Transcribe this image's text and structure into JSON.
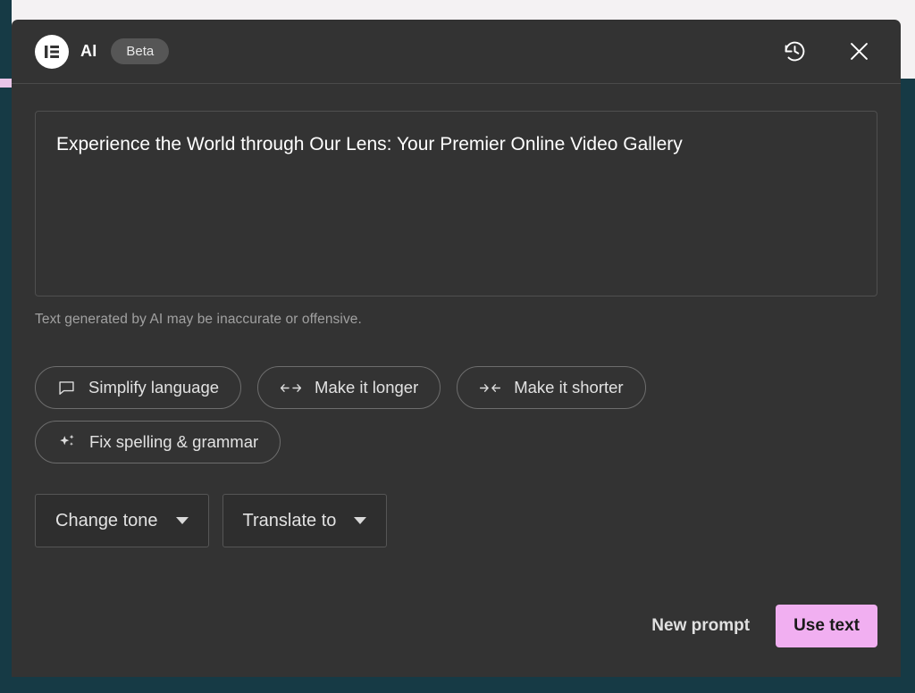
{
  "window": {
    "backdrop_color": "#163a45",
    "modal_background": "#333333",
    "accent_color": "#f1aff1"
  },
  "header": {
    "logo_icon": "elementor-logo-icon",
    "title": "AI",
    "badge": "Beta",
    "history_icon": "history-icon",
    "close_icon": "close-icon"
  },
  "main": {
    "generated_text": "Experience the World through Our Lens: Your Premier Online Video Gallery",
    "disclaimer": "Text generated by AI may be inaccurate or offensive.",
    "actions": [
      {
        "label": "Simplify language",
        "icon": "speech-bubble-icon"
      },
      {
        "label": "Make it longer",
        "icon": "expand-arrows-icon"
      },
      {
        "label": "Make it shorter",
        "icon": "collapse-arrows-icon"
      },
      {
        "label": "Fix spelling & grammar",
        "icon": "sparkles-icon"
      }
    ],
    "selects": [
      {
        "label": "Change tone",
        "icon": "chevron-down-icon"
      },
      {
        "label": "Translate to",
        "icon": "chevron-down-icon"
      }
    ]
  },
  "footer": {
    "new_prompt_label": "New prompt",
    "use_text_label": "Use text"
  }
}
